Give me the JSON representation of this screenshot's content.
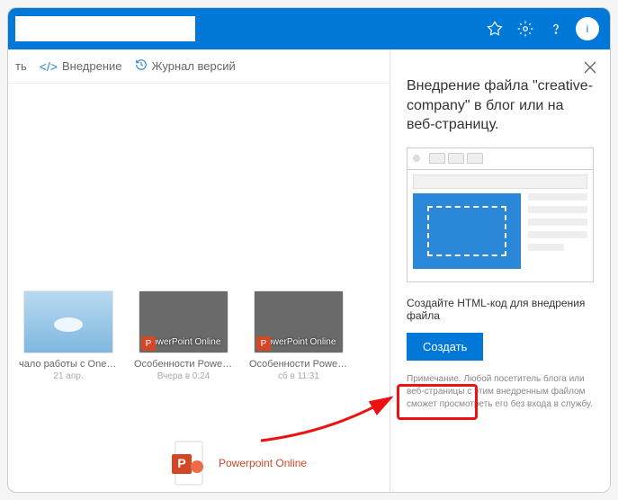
{
  "header": {
    "search_value": "",
    "avatar_initial": "i"
  },
  "toolbar": {
    "item_partial": "ть",
    "embed": "Внедрение",
    "versions": "Журнал версий"
  },
  "files": [
    {
      "name": "чало работы с OneD...",
      "date": "21 апр.",
      "thumb_label": ""
    },
    {
      "name": "Особенности PowerPoi...",
      "date": "Вчера в 0:24",
      "thumb_label": "PowerPoint Online"
    },
    {
      "name": "Особенности PowerPoi...",
      "date": "сб в 11:31",
      "thumb_label": "PowerPoint Online"
    }
  ],
  "big_file": {
    "name": "Powerpoint Online"
  },
  "panel": {
    "title": "Внедрение файла \"creative-company\" в блог или на веб-страницу.",
    "subtitle": "Создайте HTML-код для внедрения файла",
    "create_button": "Создать",
    "note": "Примечание. Любой посетитель блога или веб-страницы с этим внедренным файлом сможет просмотреть его без входа в службу."
  }
}
